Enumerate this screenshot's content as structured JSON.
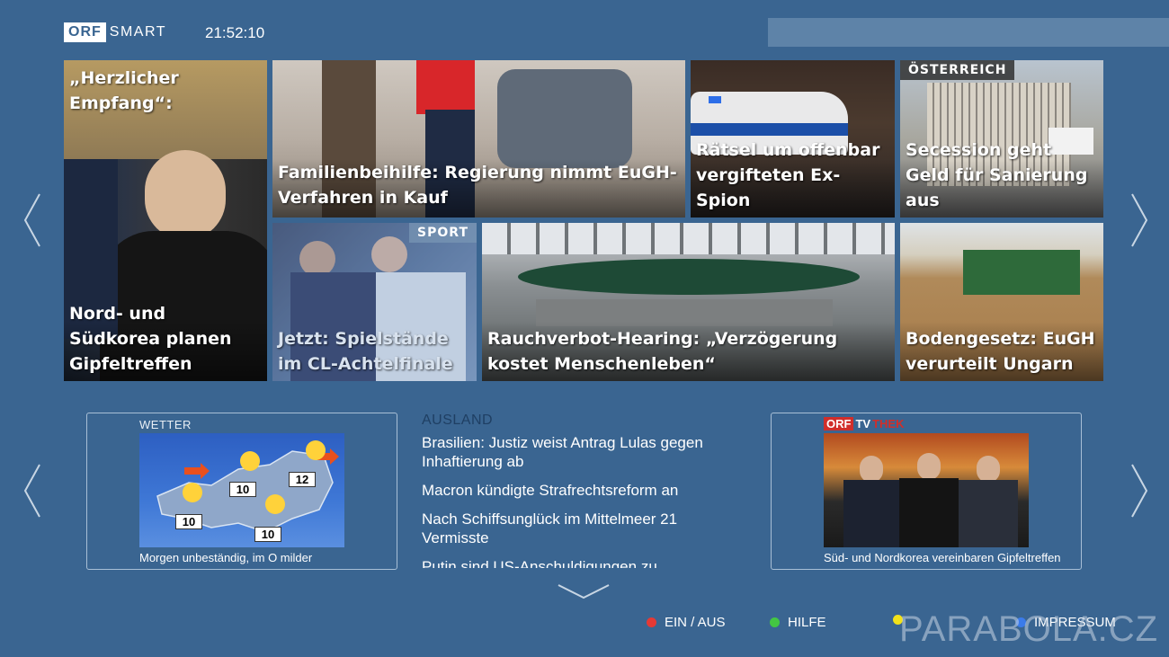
{
  "header": {
    "logo_orf": "ORF",
    "logo_smart": "SMART",
    "clock": "21:52:10"
  },
  "tiles": [
    {
      "top_caption": "„Herzlicher Empfang“:",
      "caption": "Nord- und Südkorea planen Gipfeltreffen"
    },
    {
      "caption": "Familienbeihilfe: Regierung nimmt EuGH-Verfahren in Kauf"
    },
    {
      "caption": "Rätsel um offenbar vergifteten Ex-Spion"
    },
    {
      "tag": "ÖSTERREICH",
      "caption": "Secession geht Geld für Sanierung aus"
    },
    {
      "tag": "SPORT",
      "caption": "Jetzt: Spielstände im CL-Achtelfinale"
    },
    {
      "caption": "Rauchverbot-Hearing: „Verzögerung kostet Menschenleben“"
    },
    {
      "caption": "Bodengesetz: EuGH verurteilt Ungarn"
    }
  ],
  "weather": {
    "label": "WETTER",
    "caption": "Morgen unbeständig, im O milder",
    "temps": [
      "12",
      "10",
      "10",
      "10"
    ]
  },
  "news": {
    "section": "AUSLAND",
    "items": [
      "Brasilien: Justiz weist Antrag Lulas gegen Inhaftierung ab",
      "Macron kündigte Strafrechtsreform an",
      "Nach Schiffsunglück im Mittelmeer 21 Vermisste",
      "Putin sind US-Anschuldigungen zu"
    ]
  },
  "tvthek": {
    "logo_orf": "ORF",
    "logo_tv": "TV",
    "logo_thek": "THEK",
    "caption": "Süd- und Nordkorea vereinbaren Gipfeltreffen"
  },
  "footer": {
    "red_label": "EIN / AUS",
    "green_label": "HILFE",
    "yellow_label": "",
    "blue_label": "IMPRESSUM",
    "watermark": "PARABOLA.CZ"
  },
  "colors": {
    "background": "#3a6591",
    "focus": "#e0711e",
    "red": "#e53935",
    "green": "#43c643",
    "yellow": "#f2e21a",
    "blue": "#3b7bea"
  }
}
